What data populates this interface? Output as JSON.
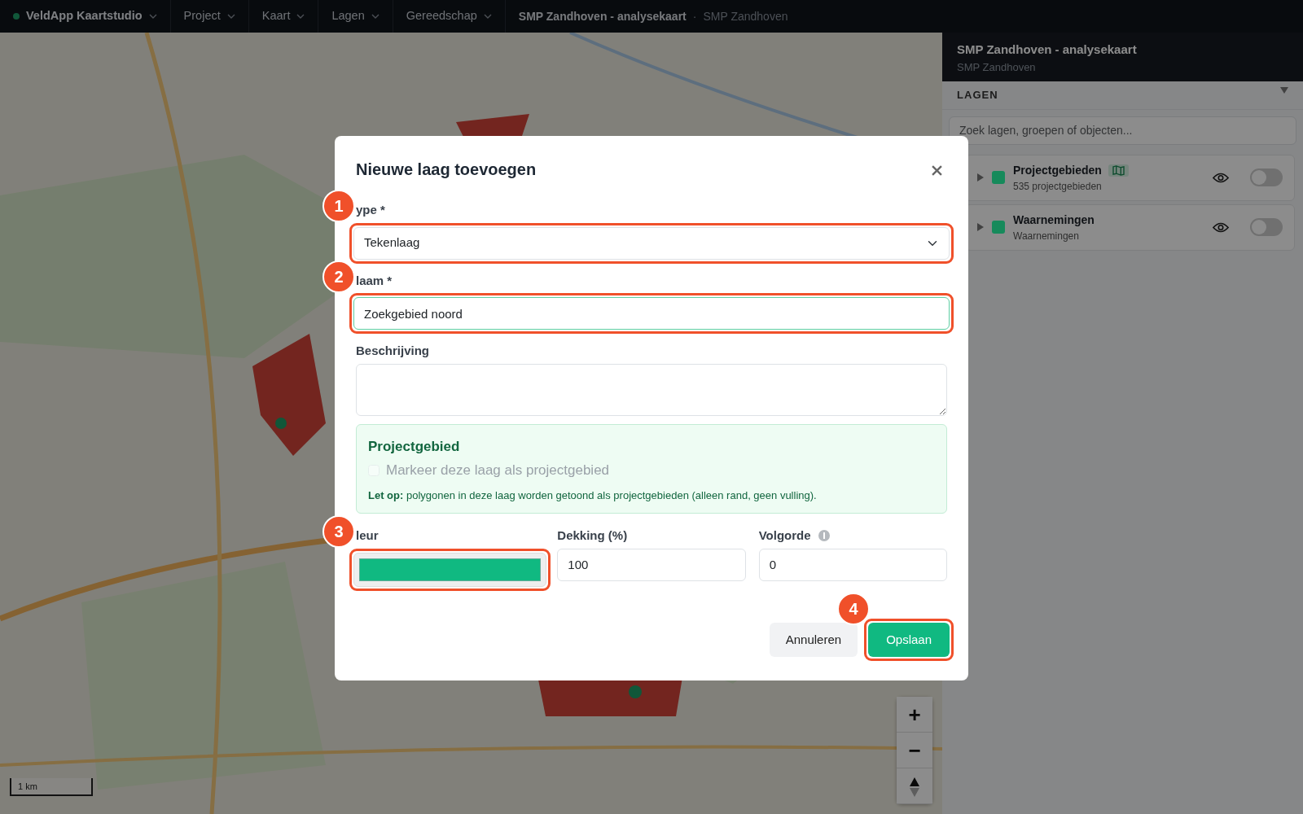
{
  "navbar": {
    "brand": "VeldApp Kaartstudio",
    "separator": "·",
    "menus": [
      "Project",
      "Kaart",
      "Lagen",
      "Gereedschap"
    ],
    "breadcrumb": [
      "SMP Zandhoven - analysekaart",
      "SMP Zandhoven"
    ]
  },
  "map": {
    "kind": "picture",
    "controls": [
      "+",
      "−"
    ],
    "scale": "1 km"
  },
  "sidebar": {
    "title": "SMP Zandhoven - analysekaart",
    "subtitle": "SMP Zandhoven",
    "section": "LAGEN",
    "search": {
      "placeholder": "Zoek lagen, groepen of objecten..."
    },
    "layers": [
      {
        "name": "Projectgebieden",
        "detail": "535 projectgebieden",
        "color": "#168a5c",
        "project_area": true,
        "on": false
      },
      {
        "name": "Waarnemingen",
        "detail": "Waarnemingen",
        "color": "#168a5c",
        "project_area": false,
        "on": false
      }
    ]
  },
  "modal": {
    "title": "Nieuwe laag toevoegen",
    "type": {
      "label": "ype *",
      "value": "Tekenlaag",
      "callout": "1"
    },
    "name": {
      "label": "laam *",
      "value": "Zoekgebied noord",
      "callout": "2"
    },
    "description": {
      "label": "Beschrijving"
    },
    "project_box": {
      "title": "Projectgebied",
      "checkbox": {
        "label": "Markeer deze laag als projectgebied",
        "checked": false,
        "disabled": true
      },
      "note": "**Let op:** polygonen in deze laag worden getoond als projectgebieden (alleen rand, geen vulling)."
    },
    "color_field": {
      "label": "leur",
      "color": "#10b981",
      "callout": "3"
    },
    "opacity": {
      "label": "Dekking (%)",
      "value": "100"
    },
    "order": {
      "label": "Volgorde",
      "value": "0"
    },
    "buttons": [
      {
        "label": "Annuleren",
        "kind": "secondary"
      },
      {
        "label": "Opslaan",
        "kind": "primary",
        "callout": "4"
      }
    ]
  }
}
